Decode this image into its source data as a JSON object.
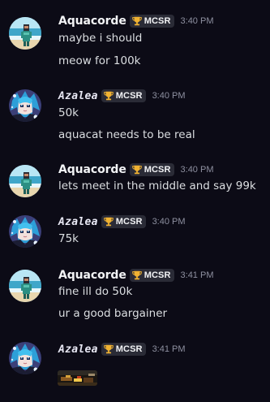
{
  "messages": [
    {
      "author": "Aquacorde",
      "tag": "MCSR",
      "time": "3:40 PM",
      "lines": [
        "maybe i should",
        "meow for 100k"
      ]
    },
    {
      "author": "Azalea",
      "tag": "MCSR",
      "time": "3:40 PM",
      "lines": [
        "50k",
        "aquacat needs to be real"
      ]
    },
    {
      "author": "Aquacorde",
      "tag": "MCSR",
      "time": "3:40 PM",
      "lines": [
        "lets meet in the middle and say 99k"
      ]
    },
    {
      "author": "Azalea",
      "tag": "MCSR",
      "time": "3:40 PM",
      "lines": [
        "75k"
      ]
    },
    {
      "author": "Aquacorde",
      "tag": "MCSR",
      "time": "3:41 PM",
      "lines": [
        "fine ill do 50k",
        "ur a good bargainer"
      ]
    },
    {
      "author": "Azalea",
      "tag": "MCSR",
      "time": "3:41 PM",
      "lines": []
    }
  ],
  "colors": {
    "background": "#0c0b16",
    "username": "#f2f3f5",
    "message_text": "#dbdee1",
    "timestamp": "#8e90a0",
    "tag_background": "#2a2b36",
    "trophy": "#f0b232"
  },
  "icons": {
    "tag": "trophy-icon",
    "aquacorde_avatar": "beach-avatar",
    "azalea_avatar": "anime-character-avatar",
    "attachment": "image-attachment"
  }
}
